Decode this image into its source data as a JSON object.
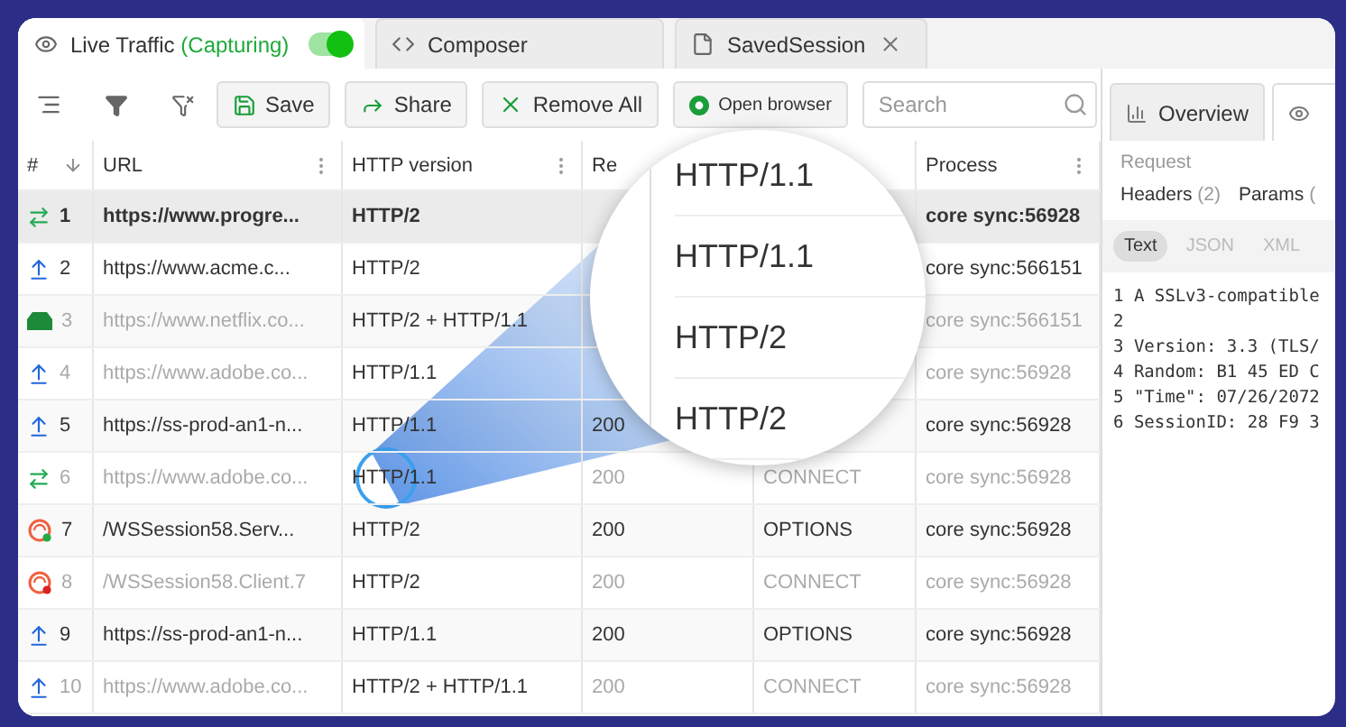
{
  "tabs": [
    {
      "kind": "live",
      "label": "Live Traffic",
      "status": "(Capturing)",
      "capturing": true,
      "selected": true
    },
    {
      "kind": "composer",
      "label": "Composer",
      "selected": false
    },
    {
      "kind": "session",
      "label": "SavedSession",
      "selected": false
    }
  ],
  "toolbar": {
    "buttons": [
      {
        "kind": "save",
        "label": "Save"
      },
      {
        "kind": "share",
        "label": "Share"
      },
      {
        "kind": "remove",
        "label": "Remove All"
      },
      {
        "kind": "browser",
        "label": "Open browser"
      }
    ],
    "search": {
      "placeholder": "Search"
    }
  },
  "table": {
    "columns": [
      {
        "label": "#",
        "sortable": true
      },
      {
        "label": "URL"
      },
      {
        "label": "HTTP version"
      },
      {
        "label": "Re"
      },
      {},
      {
        "label": "Process"
      }
    ],
    "rows": [
      {
        "kind": "tunnel",
        "num": "1",
        "url": "https://www.progre...",
        "version": "HTTP/2",
        "process": "core sync:56928",
        "selected": true,
        "dimmed": false
      },
      {
        "kind": "upload",
        "num": "2",
        "url": "https://www.acme.c...",
        "version": "HTTP/2",
        "process": "core sync:566151",
        "selected": false,
        "dimmed": false
      },
      {
        "kind": "stream",
        "num": "3",
        "url": "https://www.netflix.co...",
        "version": "HTTP/2 + HTTP/1.1",
        "process": "core sync:566151",
        "selected": false,
        "dimmed": true
      },
      {
        "kind": "upload",
        "num": "4",
        "url": "https://www.adobe.co...",
        "version": "HTTP/1.1",
        "process": "core sync:56928",
        "selected": false,
        "dimmed": true
      },
      {
        "kind": "upload",
        "num": "5",
        "url": "https://ss-prod-an1-n...",
        "version": "HTTP/1.1",
        "result": "200",
        "process": "core sync:56928",
        "selected": false,
        "dimmed": false
      },
      {
        "kind": "tunnel",
        "num": "6",
        "url": "https://www.adobe.co...",
        "version": "HTTP/1.1",
        "result": "200",
        "method": "CONNECT",
        "process": "core sync:56928",
        "selected": false,
        "dimmed": true
      },
      {
        "kind": "websocket",
        "color": "#22aa44",
        "num": "7",
        "url": "/WSSession58.Serv...",
        "version": "HTTP/2",
        "result": "200",
        "method": "OPTIONS",
        "process": "core sync:56928",
        "selected": false,
        "dimmed": false
      },
      {
        "kind": "websocket",
        "color": "#dd2222",
        "num": "8",
        "url": "/WSSession58.Client.7",
        "version": "HTTP/2",
        "result": "200",
        "method": "CONNECT",
        "process": "core sync:56928",
        "selected": false,
        "dimmed": true
      },
      {
        "kind": "upload",
        "num": "9",
        "url": "https://ss-prod-an1-n...",
        "version": "HTTP/1.1",
        "result": "200",
        "method": "OPTIONS",
        "process": "core sync:56928",
        "selected": false,
        "dimmed": false
      },
      {
        "kind": "upload",
        "num": "10",
        "url": "https://www.adobe.co...",
        "version": "HTTP/2 + HTTP/1.1",
        "result": "200",
        "method": "CONNECT",
        "process": "core sync:56928",
        "selected": false,
        "dimmed": true
      }
    ]
  },
  "magnifier": {
    "lines": [
      "HTTP/1.1",
      "HTTP/1.1",
      "HTTP/2",
      "HTTP/2"
    ]
  },
  "inspector": {
    "tabs": [
      {
        "kind": "overview",
        "label": "Overview",
        "selected": false
      },
      {
        "kind": "inspect",
        "selected": true
      }
    ],
    "section": "Request",
    "subtabs": [
      {
        "label": "Headers",
        "count": "(2)"
      },
      {
        "label": "Params",
        "count": "("
      }
    ],
    "formats": [
      {
        "label": "Text",
        "selected": true
      },
      {
        "label": "JSON",
        "selected": false
      },
      {
        "label": "XML",
        "selected": false
      }
    ],
    "lines": [
      "1 A SSLv3-compatible",
      "2",
      "3 Version: 3.3 (TLS/",
      "4 Random: B1 45 ED C",
      "5 \"Time\": 07/26/2072",
      "6 SessionID: 28 F9 3"
    ]
  }
}
